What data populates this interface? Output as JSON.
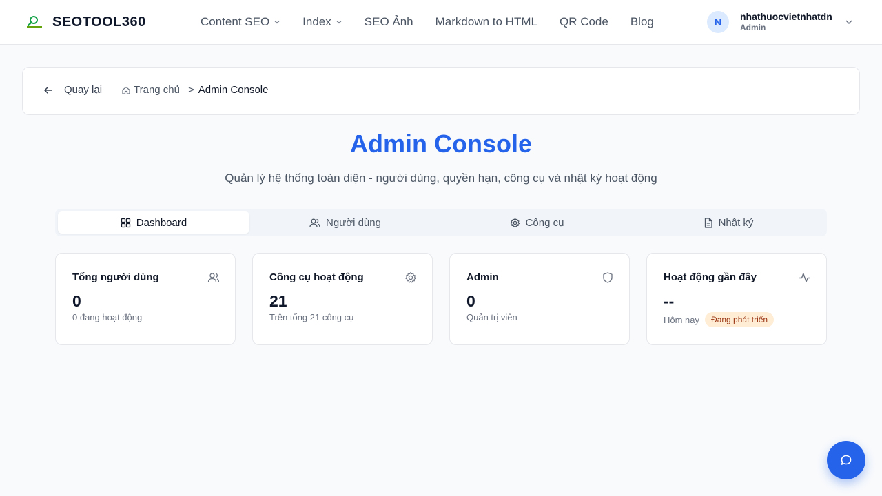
{
  "header": {
    "brand": "SEOTOOL360",
    "nav": [
      {
        "label": "Content SEO",
        "has_dropdown": true
      },
      {
        "label": "Index",
        "has_dropdown": true
      },
      {
        "label": "SEO Ảnh",
        "has_dropdown": false
      },
      {
        "label": "Markdown to HTML",
        "has_dropdown": false
      },
      {
        "label": "QR Code",
        "has_dropdown": false
      },
      {
        "label": "Blog",
        "has_dropdown": false
      }
    ],
    "user": {
      "initial": "N",
      "name": "nhathuocvietnhatdn",
      "role": "Admin"
    }
  },
  "breadcrumb": {
    "back_label": "Quay lại",
    "home_label": "Trang chủ",
    "separator": ">",
    "current": "Admin Console"
  },
  "page": {
    "title": "Admin Console",
    "subtitle": "Quản lý hệ thống toàn diện - người dùng, quyền hạn, công cụ và nhật ký hoạt động"
  },
  "tabs": [
    {
      "label": "Dashboard",
      "icon": "grid-icon",
      "active": true
    },
    {
      "label": "Người dùng",
      "icon": "users-icon",
      "active": false
    },
    {
      "label": "Công cụ",
      "icon": "gear-icon",
      "active": false
    },
    {
      "label": "Nhật ký",
      "icon": "file-text-icon",
      "active": false
    }
  ],
  "cards": [
    {
      "title": "Tổng người dùng",
      "value": "0",
      "sub": "0 đang hoạt động",
      "icon": "users-icon"
    },
    {
      "title": "Công cụ hoạt động",
      "value": "21",
      "sub": "Trên tổng 21 công cụ",
      "icon": "gear-icon"
    },
    {
      "title": "Admin",
      "value": "0",
      "sub": "Quản trị viên",
      "icon": "shield-icon"
    },
    {
      "title": "Hoạt động gần đây",
      "value": "--",
      "sub": "Hôm nay",
      "badge": "Đang phát triển",
      "icon": "activity-icon"
    }
  ],
  "colors": {
    "accent": "#2563eb",
    "badge_bg": "#ffedd5",
    "badge_text": "#9a3412"
  },
  "chat_button": {
    "icon": "chat-bubble-icon"
  }
}
